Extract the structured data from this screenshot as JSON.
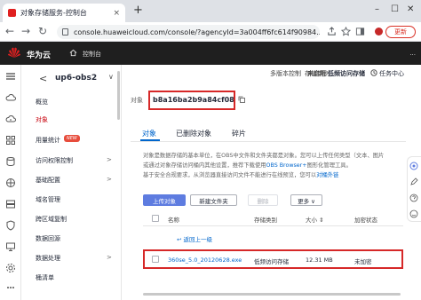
{
  "browser": {
    "tab_title": "对象存储服务-控制台",
    "tab_close": "×",
    "new_tab": "+",
    "url": "console.huaweicloud.com/console/?agencyId=3a004ff6fc614f90984...",
    "update_label": "更新",
    "win_min": "–",
    "win_max": "☐",
    "win_close": "✕",
    "back": "←",
    "forward": "→",
    "reload": "↻"
  },
  "header": {
    "brand": "华为云",
    "console": "控制台",
    "right_text": "..."
  },
  "nav": {
    "back": "<",
    "bucket": "up6-obs2",
    "chevron": "∨",
    "items": [
      {
        "label": "概览"
      },
      {
        "label": "对象"
      },
      {
        "label": "用量统计"
      },
      {
        "label": "访问权限控制"
      },
      {
        "label": "基础配置"
      },
      {
        "label": "域名管理"
      },
      {
        "label": "跨区域复制"
      },
      {
        "label": "数据回源"
      },
      {
        "label": "数据处理"
      },
      {
        "label": "桶清单"
      }
    ],
    "new_badge": "NEW",
    "chev": ">"
  },
  "meta": {
    "versioning_label": "多版本控制",
    "versioning_value": "未启用",
    "storage_class_label": "存储类别",
    "storage_class_value": "低频访问存储",
    "task_center": "任务中心"
  },
  "object": {
    "label": "对象",
    "path": "b8a16ba2b9a84cf087..."
  },
  "tabs": [
    {
      "label": "对象"
    },
    {
      "label": "已删除对象"
    },
    {
      "label": "碎片"
    }
  ],
  "info": {
    "line1": "对象是数据存储的基本单位，在OBS中文件和文件夹都是对象。您可以上传任何类型（文本、图片",
    "line2a": "或通过对象存储访问桶内其他设置，推荐下载使用",
    "line2link": "OBS Browser+",
    "line2b": "图形化管理工具。",
    "line3a": "基于安全合规要求，从浏览器直接访问文件不能进行在线预览，您可以",
    "line3link": "对桶外链"
  },
  "toolbar": {
    "upload": "上传对象",
    "new_folder": "新建文件夹",
    "delete": "删除",
    "more": "更多 ∨"
  },
  "table": {
    "headers": [
      "名称",
      "存储类别",
      "大小 ⇕",
      "加密状态"
    ],
    "back_link": "↩ 返回上一级",
    "rows": [
      {
        "name": "360se_5.0_20120628.exe",
        "storage_class": "低频访问存储",
        "size": "12.31 MB",
        "encryption": "未加密"
      }
    ]
  }
}
